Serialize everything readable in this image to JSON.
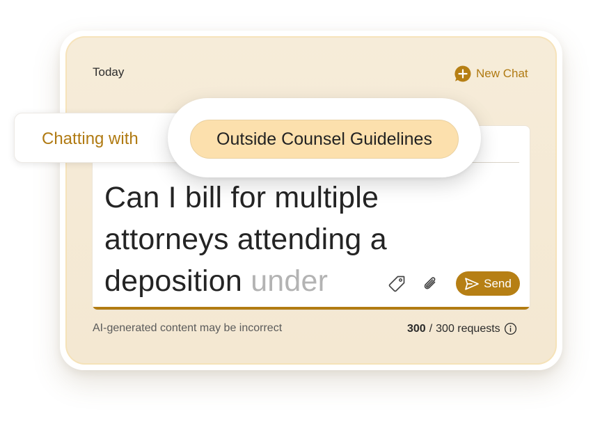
{
  "header": {
    "section_label": "Today",
    "new_chat_label": "New Chat"
  },
  "context": {
    "chatting_with_label": "Chatting with",
    "source_name": "Outside Counsel Guidelines"
  },
  "composer": {
    "query_typed": "Can I bill for multiple attorneys attending a deposition ",
    "query_suggestion": "under",
    "send_label": "Send"
  },
  "footer": {
    "disclaimer": "AI-generated content may be incorrect",
    "requests_used": "300",
    "requests_separator": "/",
    "requests_total": "300 requests"
  },
  "colors": {
    "accent": "#b67f14",
    "chip_background": "#fce0ad",
    "card_background": "#f5ead5"
  },
  "icons": {
    "new_chat": "chat-plus-icon",
    "tag": "tag-icon",
    "attach": "paperclip-icon",
    "send": "send-icon",
    "info": "info-icon"
  }
}
